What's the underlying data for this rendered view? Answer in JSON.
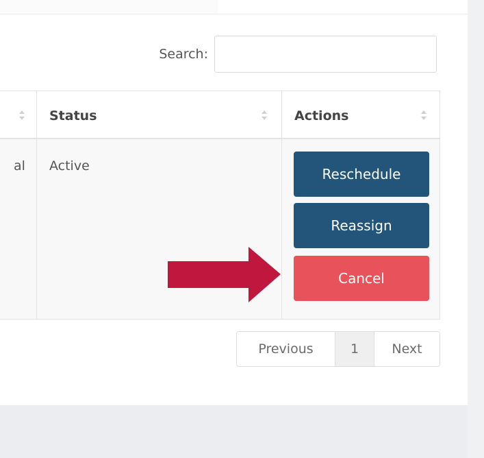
{
  "search": {
    "label": "Search:",
    "placeholder": "",
    "value": ""
  },
  "table": {
    "headers": [
      {
        "label": "",
        "sortable": true
      },
      {
        "label": "Status",
        "sortable": true
      },
      {
        "label": "Actions",
        "sortable": true
      }
    ],
    "rows": [
      {
        "partial_cell": "al",
        "status": "Active",
        "actions": [
          "Reschedule",
          "Reassign",
          "Cancel"
        ]
      }
    ]
  },
  "pagination": {
    "previous_label": "Previous",
    "current_page": "1",
    "next_label": "Next"
  },
  "annotation": {
    "arrow_icon": "right-arrow-icon",
    "arrow_color": "#c0173e"
  },
  "colors": {
    "primary_button": "#235479",
    "danger_button": "#e8525a",
    "page_background": "#ebedf0",
    "table_row_background": "#f8f8f8"
  }
}
